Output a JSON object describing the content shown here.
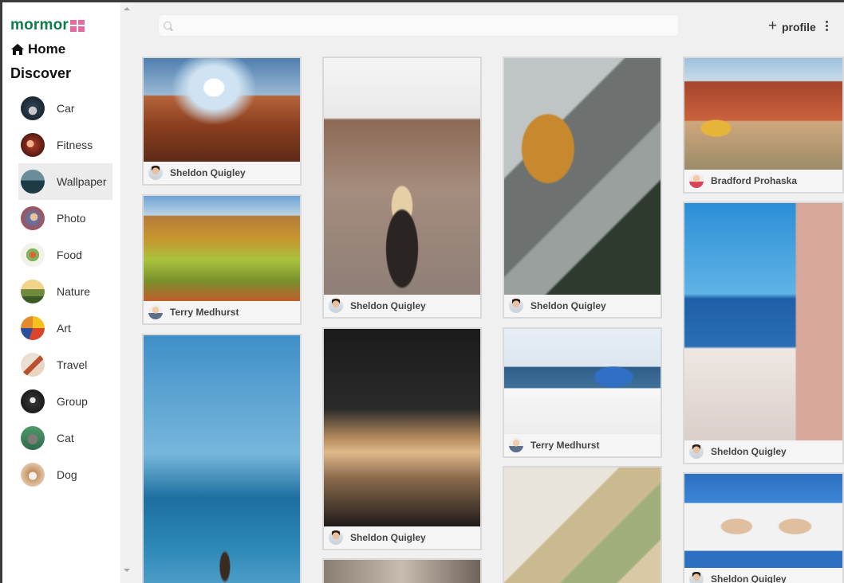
{
  "brand": {
    "name": "mormor"
  },
  "nav": {
    "home_label": "Home",
    "discover_label": "Discover"
  },
  "categories": [
    {
      "label": "Car",
      "color": "#1f2c38"
    },
    {
      "label": "Fitness",
      "color": "#8c2a1f"
    },
    {
      "label": "Wallpaper",
      "color": "#2d4c5a"
    },
    {
      "label": "Photo",
      "color": "#2e6e9e"
    },
    {
      "label": "Food",
      "color": "#d9a441"
    },
    {
      "label": "Nature",
      "color": "#b58a3a"
    },
    {
      "label": "Art",
      "color": "#d8452c"
    },
    {
      "label": "Travel",
      "color": "#c98a5a"
    },
    {
      "label": "Group",
      "color": "#1c1c1c"
    },
    {
      "label": "Cat",
      "color": "#3b7a55"
    },
    {
      "label": "Dog",
      "color": "#c58a52"
    }
  ],
  "active_category": "Wallpaper",
  "header": {
    "search_placeholder": "",
    "add_icon": "+",
    "profile_label": "profile"
  },
  "pins": [
    {
      "author": "Sheldon Quigley"
    },
    {
      "author": "Terry Medhurst"
    },
    {
      "author": ""
    },
    {
      "author": "Sheldon Quigley"
    },
    {
      "author": "Sheldon Quigley"
    },
    {
      "author": ""
    },
    {
      "author": "Sheldon Quigley"
    },
    {
      "author": "Terry Medhurst"
    },
    {
      "author": ""
    },
    {
      "author": "Bradford Prohaska"
    },
    {
      "author": "Sheldon Quigley"
    },
    {
      "author": "Sheldon Quigley"
    }
  ],
  "colors": {
    "brand": "#0f7a4a",
    "brand_logo": "#e46aa0",
    "background": "#f0f0f0"
  }
}
